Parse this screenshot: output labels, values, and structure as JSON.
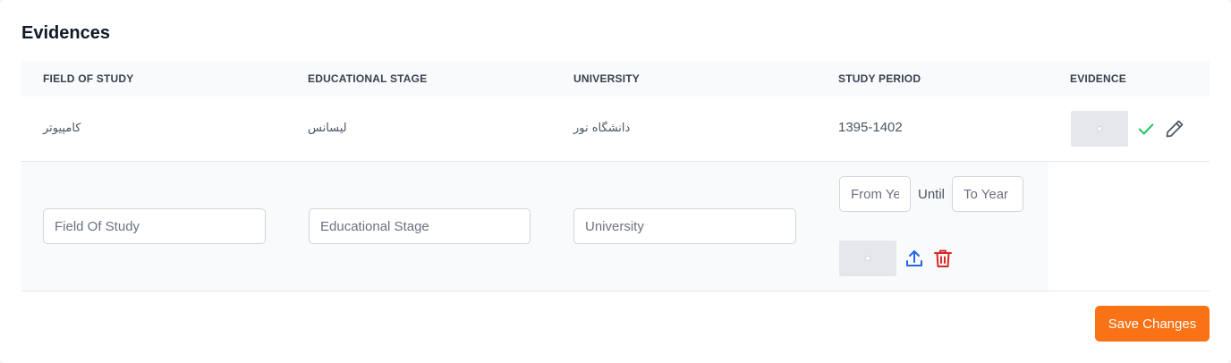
{
  "section": {
    "title": "Evidences"
  },
  "table": {
    "columns": [
      "Field Of Study",
      "Educational Stage",
      "University",
      "Study Period",
      "Evidence"
    ],
    "rows": [
      {
        "field_of_study": "کامپیوتر",
        "educational_stage": "لیسانس",
        "university": "دانشگاه نور",
        "study_period": "1395-1402"
      }
    ]
  },
  "new_row": {
    "field_of_study_placeholder": "Field Of Study",
    "educational_stage_placeholder": "Educational Stage",
    "university_placeholder": "University",
    "from_year_placeholder": "From Year",
    "until_label": "Until",
    "to_year_placeholder": "To Year"
  },
  "actions": {
    "save_label": "Save Changes"
  },
  "icons": {
    "confirm": "check-icon",
    "edit": "pencil-icon",
    "upload": "upload-icon",
    "delete": "trash-icon"
  },
  "colors": {
    "accent": "#f97316",
    "check": "#22c55e",
    "upload": "#2563eb",
    "delete": "#dc2626"
  }
}
